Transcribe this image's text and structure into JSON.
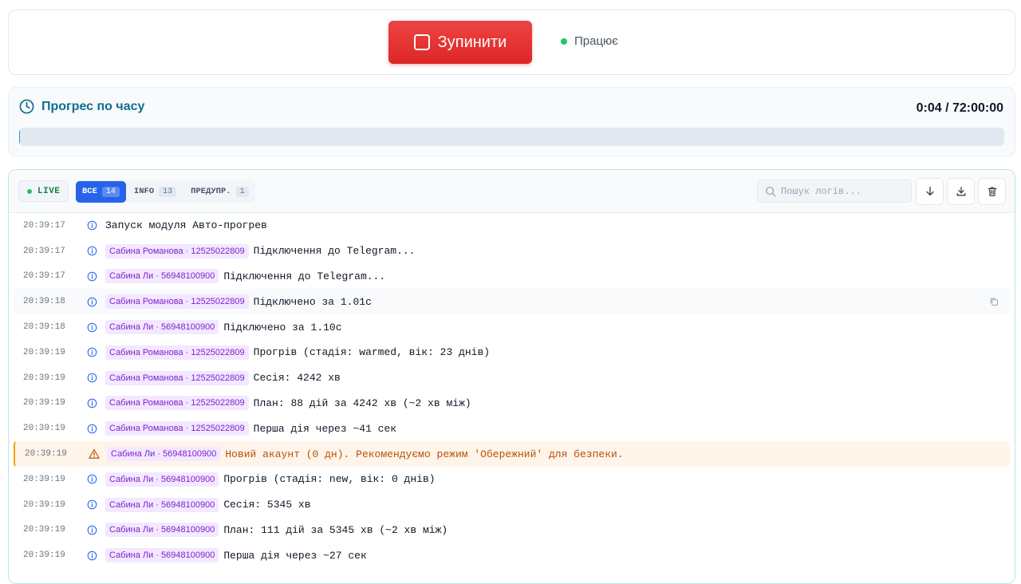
{
  "control": {
    "stop_label": "Зупинити",
    "status_text": "Працює",
    "status_color": "#22c55e"
  },
  "progress": {
    "title": "Прогрес по часу",
    "time_text": "0:04 / 72:00:00",
    "fraction": 0.0009
  },
  "log": {
    "live_label": "LIVE",
    "filters": [
      {
        "label": "ВСЕ",
        "count": "14",
        "active": true
      },
      {
        "label": "INFO",
        "count": "13",
        "active": false
      },
      {
        "label": "ПРЕДУПР.",
        "count": "1",
        "active": false
      }
    ],
    "search_placeholder": "Пошук логів...",
    "rows": [
      {
        "time": "20:39:17",
        "level": "info",
        "tag": "",
        "message": "Запуск модуля Авто-прогрев"
      },
      {
        "time": "20:39:17",
        "level": "info",
        "tag": "Сабина Романова · 12525022809",
        "message": "Підключення до Telegram..."
      },
      {
        "time": "20:39:17",
        "level": "info",
        "tag": "Сабина Ли · 56948100900",
        "message": "Підключення до Telegram..."
      },
      {
        "time": "20:39:18",
        "level": "info",
        "tag": "Сабина Романова · 12525022809",
        "message": "Підключено за 1.01с",
        "hover": true
      },
      {
        "time": "20:39:18",
        "level": "info",
        "tag": "Сабина Ли · 56948100900",
        "message": "Підключено за 1.10с"
      },
      {
        "time": "20:39:19",
        "level": "info",
        "tag": "Сабина Романова · 12525022809",
        "message": "Прогрів (стадія: warmed, вік: 23 днів)"
      },
      {
        "time": "20:39:19",
        "level": "info",
        "tag": "Сабина Романова · 12525022809",
        "message": "Сесія: 4242 хв"
      },
      {
        "time": "20:39:19",
        "level": "info",
        "tag": "Сабина Романова · 12525022809",
        "message": "План: 88 дій за 4242 хв (~2 хв між)"
      },
      {
        "time": "20:39:19",
        "level": "info",
        "tag": "Сабина Романова · 12525022809",
        "message": "Перша дія через ~41 сек"
      },
      {
        "time": "20:39:19",
        "level": "warn",
        "tag": "Сабина Ли · 56948100900",
        "message": "Новий акаунт (0 дн). Рекомендуємо режим 'Обережний' для безпеки."
      },
      {
        "time": "20:39:19",
        "level": "info",
        "tag": "Сабина Ли · 56948100900",
        "message": "Прогрів (стадія: new, вік: 0 днів)"
      },
      {
        "time": "20:39:19",
        "level": "info",
        "tag": "Сабина Ли · 56948100900",
        "message": "Сесія: 5345 хв"
      },
      {
        "time": "20:39:19",
        "level": "info",
        "tag": "Сабина Ли · 56948100900",
        "message": "План: 111 дій за 5345 хв (~2 хв між)"
      },
      {
        "time": "20:39:19",
        "level": "info",
        "tag": "Сабина Ли · 56948100900",
        "message": "Перша дія через ~27 сек"
      }
    ]
  }
}
